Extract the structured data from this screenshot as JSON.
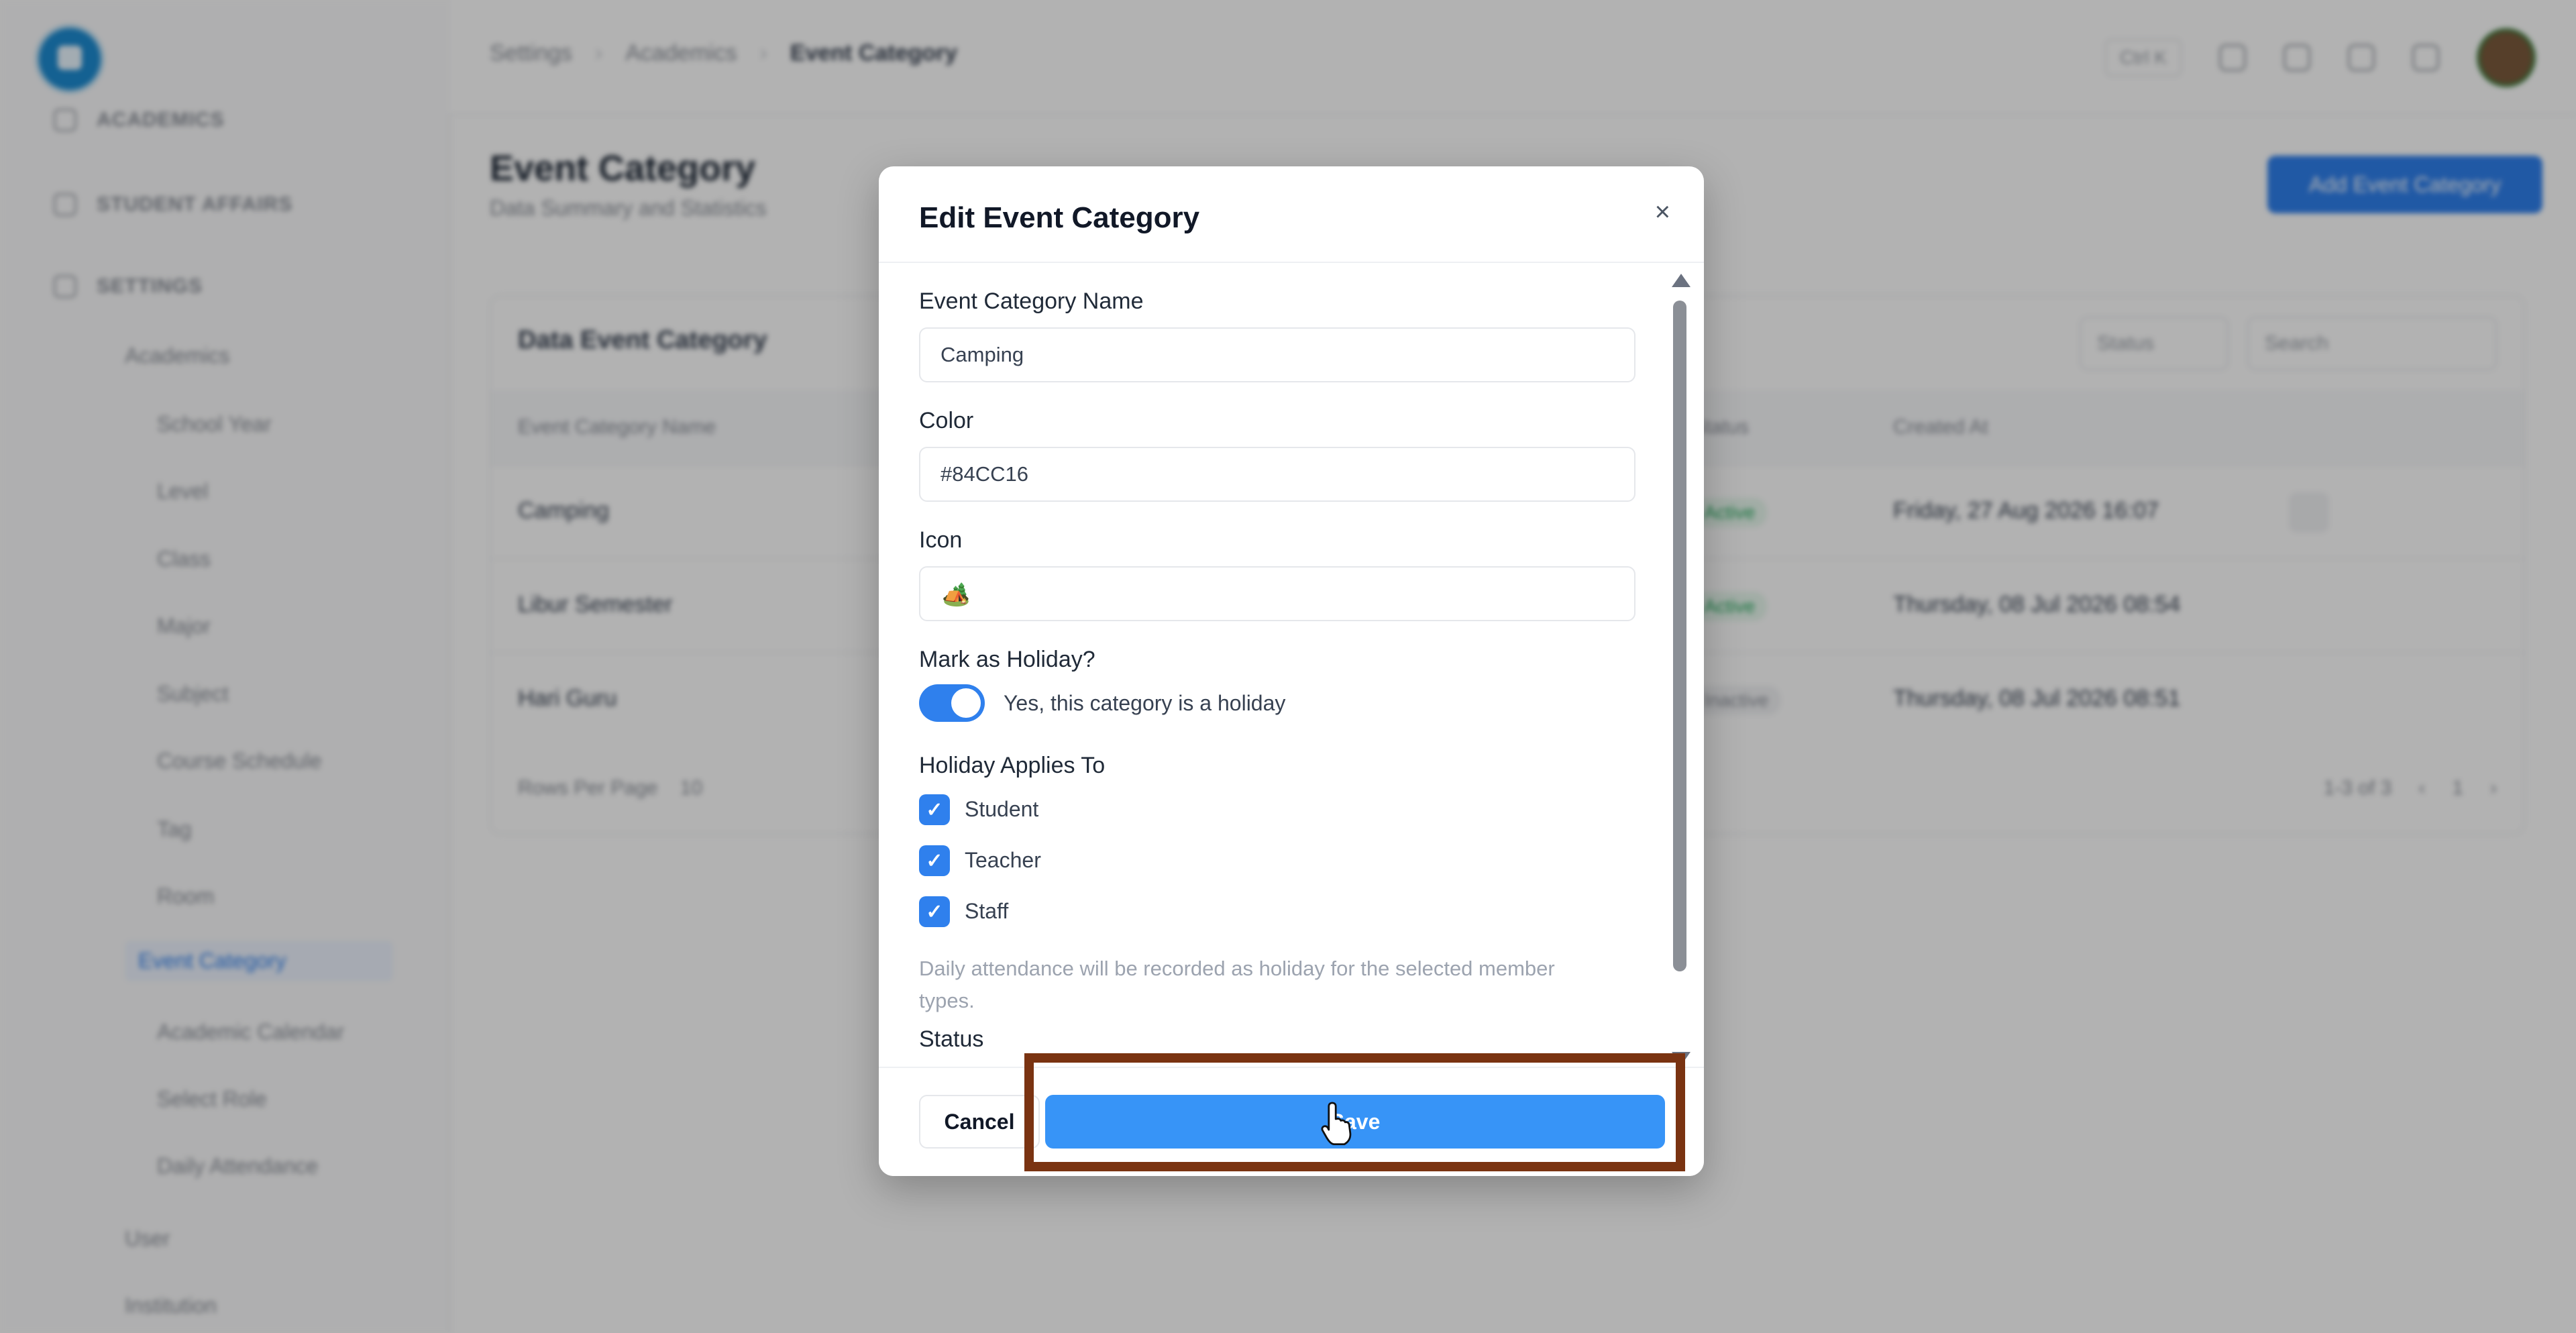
{
  "sidebar": {
    "groups": [
      "ACADEMICS",
      "STUDENT AFFAIRS",
      "SETTINGS"
    ],
    "sub_header": "Academics",
    "items": [
      "School Year",
      "Level",
      "Class",
      "Major",
      "Subject",
      "Course Schedule",
      "Tag",
      "Room",
      "Event Category",
      "Academic Calendar",
      "Select Role",
      "Daily Attendance"
    ],
    "footer_items": [
      "User",
      "Institution"
    ]
  },
  "breadcrumb": [
    "Settings",
    "Academics",
    "Event Category"
  ],
  "header": {
    "shortcut": "Ctrl K"
  },
  "page": {
    "title": "Event Category",
    "subtitle": "Data Summary and Statistics",
    "add_button": "Add Event Category"
  },
  "table": {
    "title": "Data Event Category",
    "filter": "Status",
    "search_placeholder": "Search",
    "headers": [
      "Event Category Name",
      "Status",
      "Created At"
    ],
    "rows": [
      {
        "name": "Camping",
        "status": "Active",
        "created": "Friday, 27 Aug 2026 16:07"
      },
      {
        "name": "Libur Semester",
        "status": "Active",
        "created": "Thursday, 08 Jul 2026 08:54"
      },
      {
        "name": "Hari Guru",
        "status": "Inactive",
        "created": "Thursday, 08 Jul 2026 08:51"
      }
    ],
    "rows_per_page_label": "Rows Per Page",
    "rows_per_page": "10",
    "range": "1-3 of 3",
    "current_page": "1"
  },
  "modal": {
    "title": "Edit Event Category",
    "close_icon": "×",
    "name_label": "Event Category Name",
    "name_value": "Camping",
    "color_label": "Color",
    "color_value": "#84CC16",
    "icon_label": "Icon",
    "icon_value": "🏕️",
    "holiday_label": "Mark as Holiday?",
    "holiday_on": true,
    "holiday_text": "Yes, this category is a holiday",
    "applies_label": "Holiday Applies To",
    "applies": [
      {
        "label": "Student",
        "checked": true
      },
      {
        "label": "Teacher",
        "checked": true
      },
      {
        "label": "Staff",
        "checked": true
      }
    ],
    "help_text": "Daily attendance will be recorded as holiday for the selected member types.",
    "status_label": "Status",
    "cancel_label": "Cancel",
    "save_label": "Save"
  },
  "colors": {
    "accent": "#2f80ed",
    "highlight": "#7a3311"
  }
}
